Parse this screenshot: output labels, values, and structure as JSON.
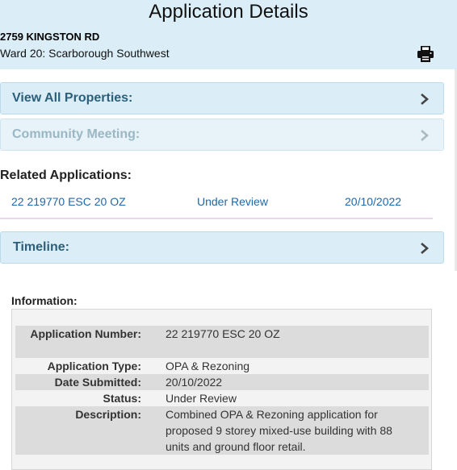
{
  "header": {
    "title": "Application Details",
    "address": "2759 KINGSTON RD",
    "ward": "Ward 20: Scarborough Southwest"
  },
  "panels": {
    "view_all": "View All Properties:",
    "community": "Community Meeting:",
    "timeline": "Timeline:"
  },
  "related": {
    "heading": "Related Applications:",
    "rows": [
      {
        "number": "22 219770 ESC 20 OZ",
        "status": "Under Review",
        "date": "20/10/2022"
      }
    ]
  },
  "information": {
    "heading": "Information:",
    "fields": [
      {
        "key": "Application Number:",
        "value": "22 219770 ESC 20 OZ"
      },
      {
        "key": "Application Type:",
        "value": "OPA & Rezoning"
      },
      {
        "key": "Date Submitted:",
        "value": "20/10/2022"
      },
      {
        "key": "Status:",
        "value": "Under Review"
      },
      {
        "key": "Description:",
        "value": "Combined OPA & Rezoning application for proposed 9 storey mixed-use building with 88 units and ground floor retail."
      }
    ]
  },
  "colors": {
    "header_bg": "#dbeef7",
    "panel_text": "#2b5f7a",
    "link": "#2168a8"
  }
}
